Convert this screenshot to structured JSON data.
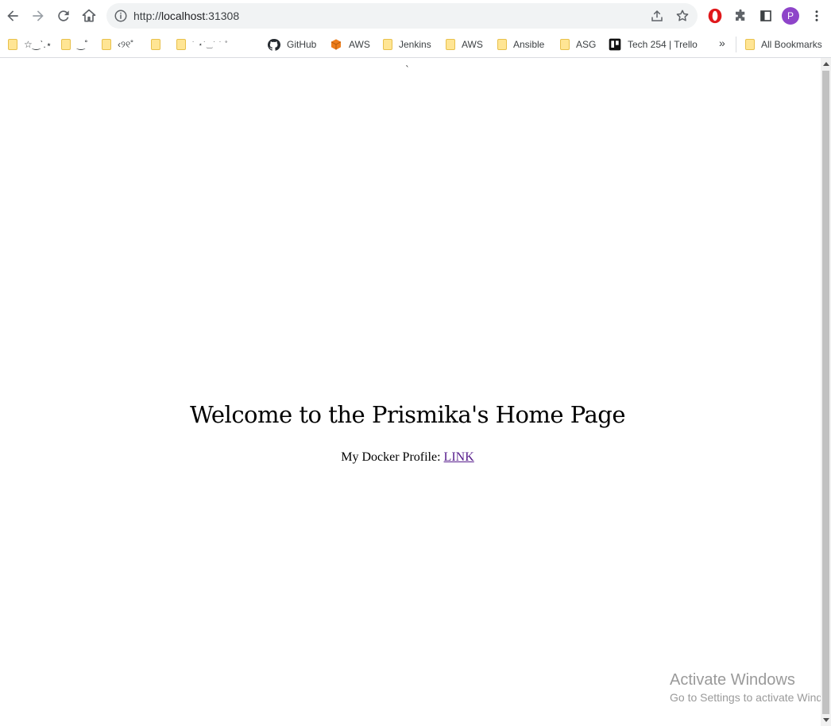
{
  "browser": {
    "url_scheme": "http://",
    "url_host": "localhost",
    "url_port": ":31308",
    "avatar_initial": "P"
  },
  "bookmarks": {
    "items": [
      {
        "label": "☆‿ˋ.⋆",
        "icon": "folder-icon"
      },
      {
        "label": "‿˚",
        "icon": "folder-icon"
      },
      {
        "label": "‹୨୧˚",
        "icon": "folder-icon"
      },
      {
        "label": "",
        "icon": "folder-icon"
      },
      {
        "label": "˙   ⋆˙‿˙ ˙   ˚",
        "icon": "folder-icon"
      },
      {
        "label": "GitHub",
        "icon": "github-icon"
      },
      {
        "label": "AWS",
        "icon": "aws-icon"
      },
      {
        "label": "Jenkins",
        "icon": "folder-icon"
      },
      {
        "label": "AWS",
        "icon": "folder-icon"
      },
      {
        "label": "Ansible",
        "icon": "folder-icon"
      },
      {
        "label": "ASG",
        "icon": "folder-icon"
      },
      {
        "label": "Tech 254 | Trello",
        "icon": "trello-icon"
      }
    ],
    "overflow": "»",
    "all_bookmarks": "All Bookmarks"
  },
  "page": {
    "tick": "`",
    "title": "Welcome to the Prismika's Home Page",
    "profile_label": "My Docker Profile: ",
    "profile_link": "LINK"
  },
  "watermark": {
    "line1": "Activate Windows",
    "line2": "Go to Settings to activate Windows."
  },
  "colors": {
    "link": "#551a8b",
    "avatar": "#8e44c9",
    "opera_red": "#e0181b"
  }
}
